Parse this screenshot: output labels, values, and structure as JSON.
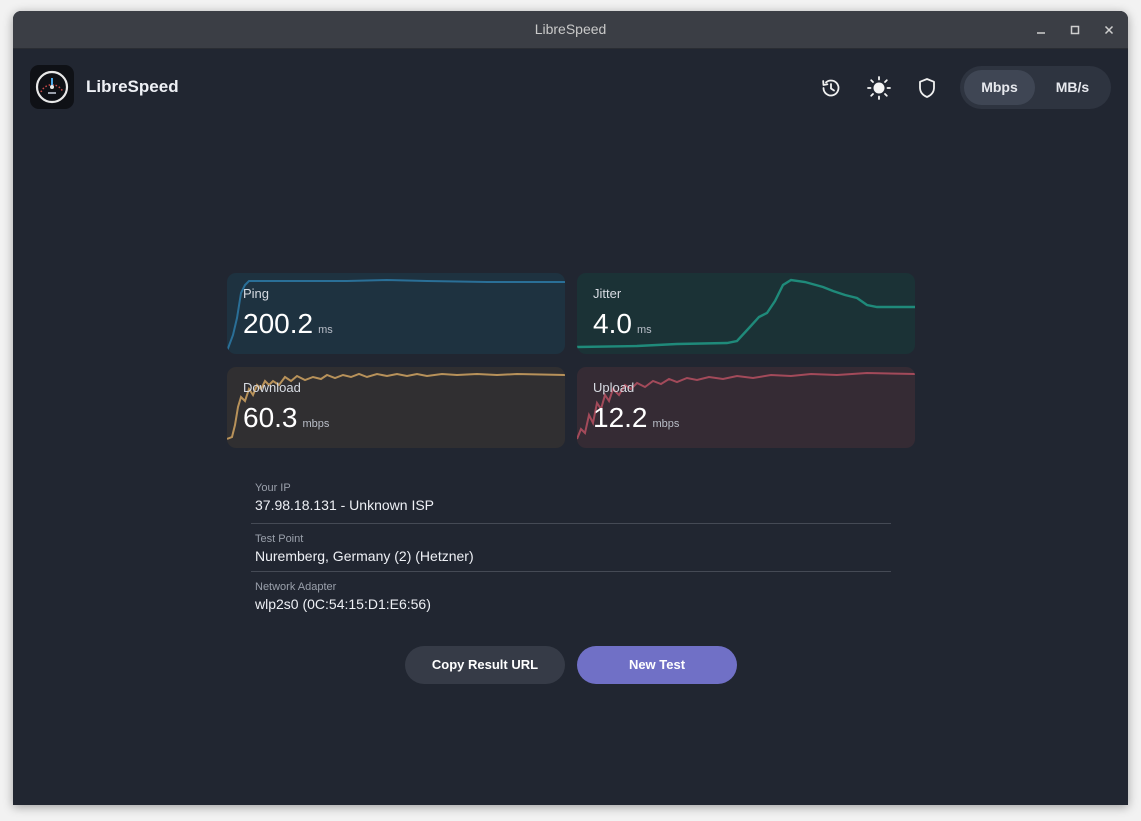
{
  "window": {
    "title": "LibreSpeed"
  },
  "header": {
    "app_name": "LibreSpeed",
    "icons": [
      "history-icon",
      "sun-icon",
      "shield-icon"
    ],
    "units": {
      "options": [
        "Mbps",
        "MB/s"
      ],
      "selected": "Mbps"
    }
  },
  "metrics": {
    "ping": {
      "label": "Ping",
      "value": "200.2",
      "unit": "ms",
      "color": "#2a6f97"
    },
    "jitter": {
      "label": "Jitter",
      "value": "4.0",
      "unit": "ms",
      "color": "#1f8a7a"
    },
    "download": {
      "label": "Download",
      "value": "60.3",
      "unit": "mbps",
      "color": "#b8925a"
    },
    "upload": {
      "label": "Upload",
      "value": "12.2",
      "unit": "mbps",
      "color": "#a34a5a"
    }
  },
  "info": {
    "ip": {
      "label": "Your IP",
      "value": "37.98.18.131 - Unknown ISP"
    },
    "test_point": {
      "label": "Test Point",
      "value": "Nuremberg, Germany (2) (Hetzner)"
    },
    "adapter": {
      "label": "Network Adapter",
      "value": "wlp2s0 (0C:54:15:D1:E6:56)"
    }
  },
  "actions": {
    "copy": "Copy Result URL",
    "new_test": "New Test"
  },
  "colors": {
    "accent": "#7070c6",
    "background": "#212631"
  }
}
